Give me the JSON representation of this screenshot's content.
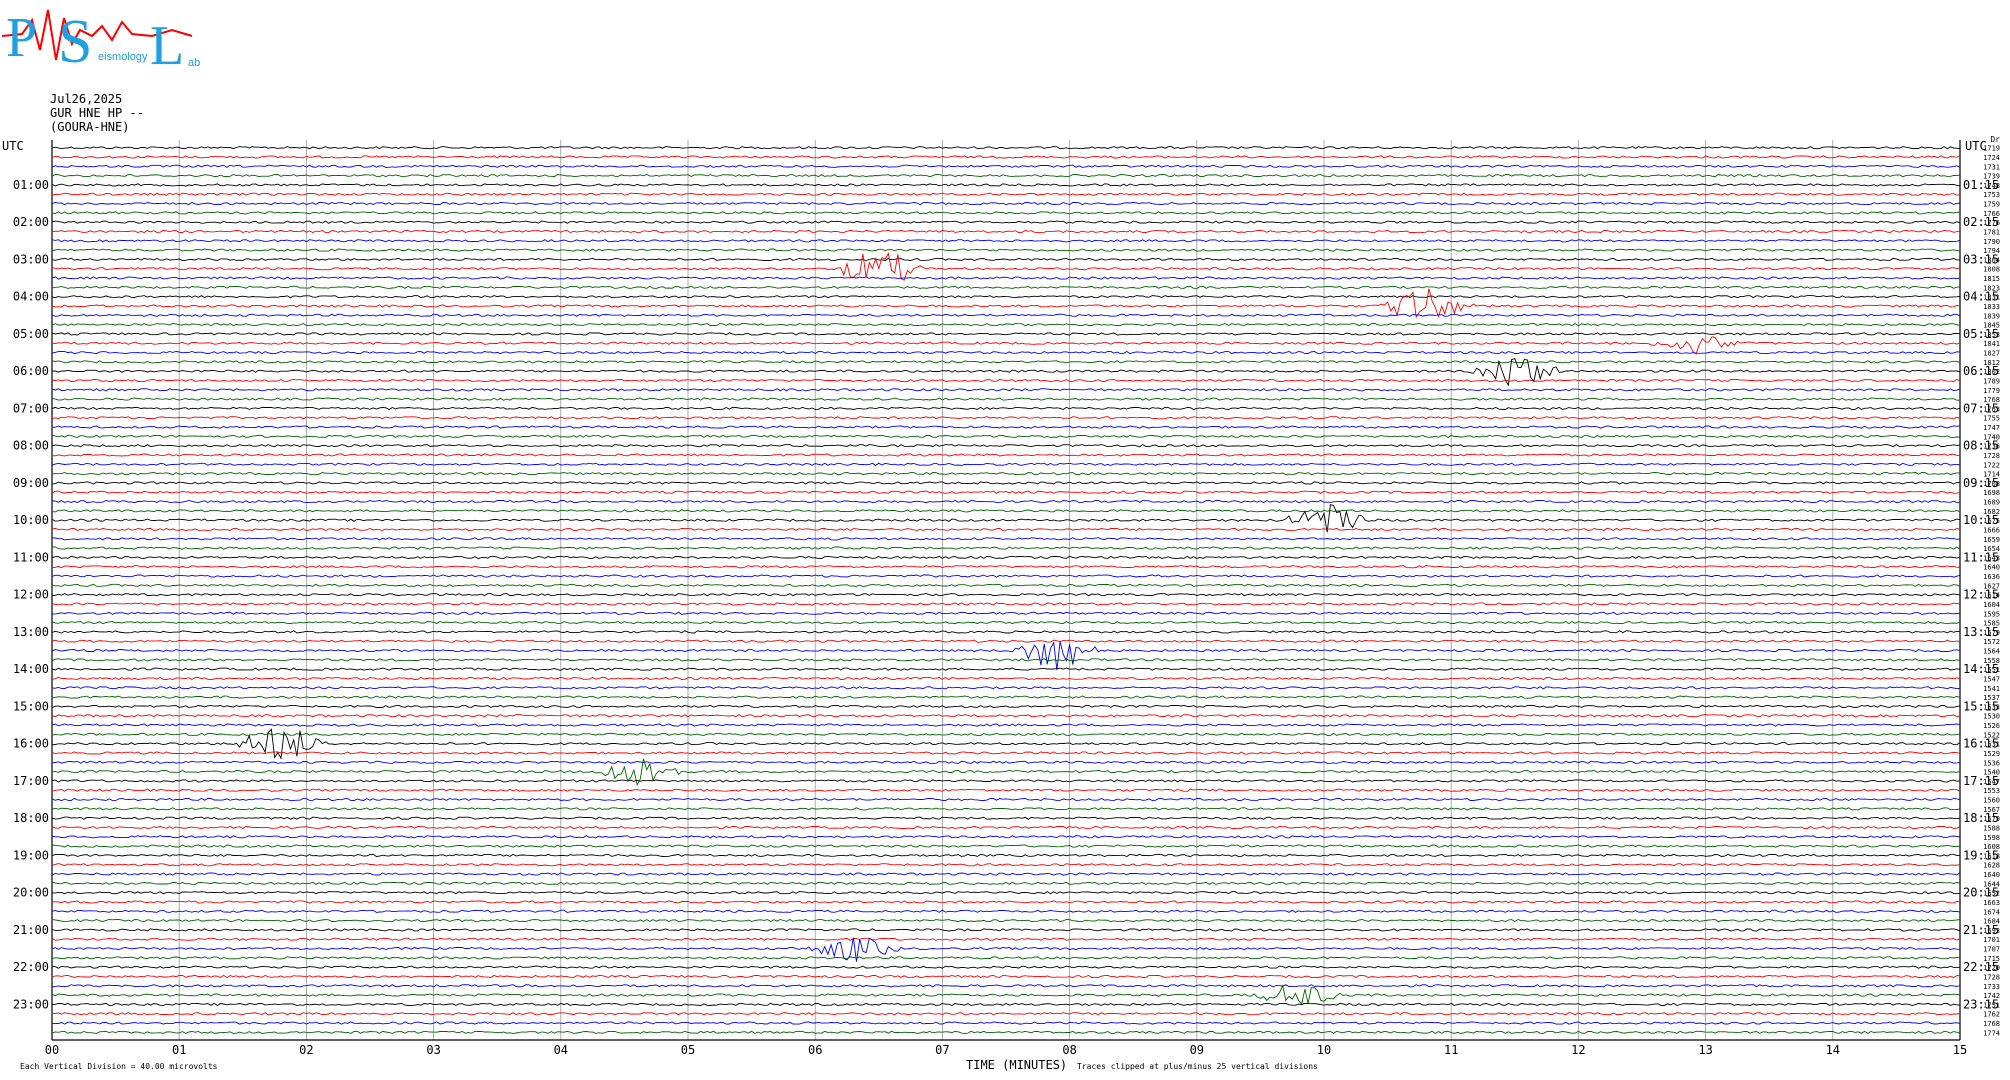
{
  "logo": {
    "letters": [
      "P",
      "S",
      "L"
    ],
    "small_texts": [
      "eismology",
      "ab"
    ]
  },
  "header": {
    "date": "Jul26,2025",
    "channel": "GUR HNE HP --",
    "station": "(GOURA-HNE)"
  },
  "left_axis_title": "UTC",
  "right_axis_title": "UTC",
  "left_time_labels": [
    "01:00",
    "02:00",
    "03:00",
    "04:00",
    "05:00",
    "06:00",
    "07:00",
    "08:00",
    "09:00",
    "10:00",
    "11:00",
    "12:00",
    "13:00",
    "14:00",
    "15:00",
    "16:00",
    "17:00",
    "18:00",
    "19:00",
    "20:00",
    "21:00",
    "22:00",
    "23:00"
  ],
  "right_time_labels": [
    "01:15",
    "02:15",
    "03:15",
    "04:15",
    "05:15",
    "06:15",
    "07:15",
    "08:15",
    "09:15",
    "10:15",
    "11:15",
    "12:15",
    "13:15",
    "14:15",
    "15:15",
    "16:15",
    "17:15",
    "18:15",
    "19:15",
    "20:15",
    "21:15",
    "22:15",
    "23:15"
  ],
  "footer": {
    "xlabel": "TIME (MINUTES)",
    "clip_note": "Traces clipped at plus/minus 25 vertical divisions",
    "scale_note": "Each Vertical Division =   40.00 microvolts"
  },
  "colors": {
    "cycle": [
      "#000000",
      "#ff0000",
      "#0000ff",
      "#006400"
    ]
  },
  "chart_data": {
    "type": "line",
    "title": "",
    "xlabel": "TIME (MINUTES)",
    "ylabel": "UTC",
    "xlim": [
      0,
      15
    ],
    "x_ticks": [
      "00",
      "01",
      "02",
      "03",
      "04",
      "05",
      "06",
      "07",
      "08",
      "09",
      "10",
      "11",
      "12",
      "13",
      "14",
      "15"
    ],
    "rows": 96,
    "minutes_per_row": 15,
    "right_column_header": "Dr",
    "rms_values": [
      1719,
      1724,
      1731,
      1739,
      1748,
      1753,
      1759,
      1766,
      1776,
      1781,
      1790,
      1794,
      1804,
      1808,
      1815,
      1823,
      1831,
      1833,
      1839,
      1845,
      1853,
      1841,
      1827,
      1812,
      1802,
      1789,
      1779,
      1768,
      1763,
      1755,
      1747,
      1740,
      1736,
      1728,
      1722,
      1714,
      1708,
      1698,
      1689,
      1682,
      1675,
      1666,
      1659,
      1654,
      1643,
      1640,
      1636,
      1627,
      1614,
      1604,
      1595,
      1585,
      1579,
      1572,
      1564,
      1558,
      1551,
      1547,
      1541,
      1537,
      1533,
      1530,
      1526,
      1522,
      1531,
      1529,
      1536,
      1540,
      1547,
      1553,
      1560,
      1567,
      1579,
      1588,
      1598,
      1608,
      1618,
      1628,
      1640,
      1644,
      1652,
      1663,
      1674,
      1684,
      1693,
      1701,
      1707,
      1715,
      1720,
      1728,
      1733,
      1742,
      1751,
      1762,
      1768,
      1774
    ],
    "events": [
      {
        "row": 13,
        "minute": 6.5,
        "amp": 1.6
      },
      {
        "row": 17,
        "minute": 10.8,
        "amp": 1.4
      },
      {
        "row": 21,
        "minute": 12.9,
        "amp": 0.8
      },
      {
        "row": 24,
        "minute": 11.5,
        "amp": 1.5
      },
      {
        "row": 40,
        "minute": 10.0,
        "amp": 1.3
      },
      {
        "row": 54,
        "minute": 7.9,
        "amp": 1.6
      },
      {
        "row": 64,
        "minute": 1.8,
        "amp": 1.5
      },
      {
        "row": 67,
        "minute": 4.6,
        "amp": 1.2
      },
      {
        "row": 86,
        "minute": 6.3,
        "amp": 1.1
      },
      {
        "row": 91,
        "minute": 9.8,
        "amp": 1.0
      }
    ]
  }
}
